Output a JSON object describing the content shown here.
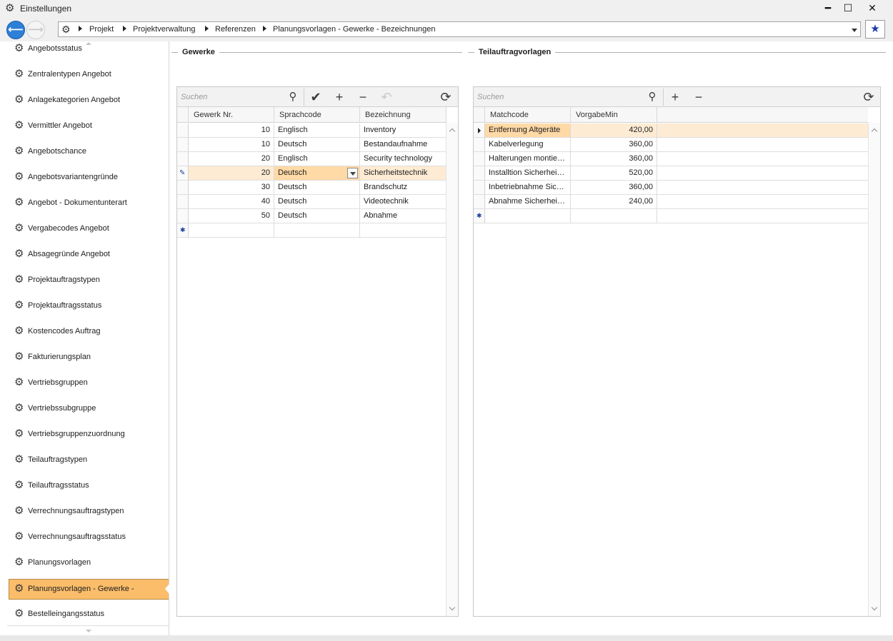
{
  "window": {
    "title": "Einstellungen",
    "controls": {
      "minimize": "━",
      "maximize": "☐",
      "close": "✕"
    }
  },
  "nav": {
    "breadcrumb": [
      "Projekt",
      "Projektverwaltung",
      "Referenzen",
      "Planungsvorlagen - Gewerke - Bezeichnungen"
    ],
    "icons": {
      "back": "back-arrow-icon",
      "forward": "forward-arrow-icon",
      "favorite": "star-icon"
    }
  },
  "sidebar": {
    "items": [
      "Angebotsstatus",
      "Zentralentypen Angebot",
      "Anlagekategorien Angebot",
      "Vermittler Angebot",
      "Angebotschance",
      "Angebotsvariantengründe",
      "Angebot - Dokumentunterart",
      "Vergabecodes Angebot",
      "Absagegründe Angebot",
      "Projektauftragstypen",
      "Projektauftragsstatus",
      "Kostencodes Auftrag",
      "Fakturierungsplan",
      "Vertriebsgruppen",
      "Vertriebssubgruppe",
      "Vertriebsgruppenzuordnung",
      "Teilauftragstypen",
      "Teilauftragsstatus",
      "Verrechnungsauftragstypen",
      "Verrechnungsauftragsstatus",
      "Planungsvorlagen",
      "Planungsvorlagen - Gewerke -",
      "Bestelleingangsstatus"
    ],
    "active_index": 21,
    "active_color": "#fbbd6a"
  },
  "gewerke": {
    "section_title": "Gewerke",
    "search_placeholder": "Suchen",
    "columns": [
      "Gewerk Nr.",
      "Sprachcode",
      "Bezeichnung"
    ],
    "rows": [
      {
        "nr": "10",
        "sprache": "Englisch",
        "bez": "Inventory"
      },
      {
        "nr": "10",
        "sprache": "Deutsch",
        "bez": "Bestandaufnahme"
      },
      {
        "nr": "20",
        "sprache": "Englisch",
        "bez": "Security technology"
      },
      {
        "nr": "20",
        "sprache": "Deutsch",
        "bez": "Sicherheitstechnik"
      },
      {
        "nr": "30",
        "sprache": "Deutsch",
        "bez": "Brandschutz"
      },
      {
        "nr": "40",
        "sprache": "Deutsch",
        "bez": "Videotechnik"
      },
      {
        "nr": "50",
        "sprache": "Deutsch",
        "bez": "Abnahme"
      }
    ],
    "editing_row": 3,
    "new_row_marker": "✱",
    "edit_marker": "✎"
  },
  "teilauftrag": {
    "section_title": "Teilauftragvorlagen",
    "search_placeholder": "Suchen",
    "columns": [
      "Matchcode",
      "VorgabeMin"
    ],
    "rows": [
      {
        "match": "Entfernung Altgeräte",
        "min": "420,00"
      },
      {
        "match": "Kabelverlegung",
        "min": "360,00"
      },
      {
        "match": "Halterungen montier…",
        "min": "360,00"
      },
      {
        "match": "Installtion Sicherheit…",
        "min": "520,00"
      },
      {
        "match": "Inbetriebnahme Sich…",
        "min": "360,00"
      },
      {
        "match": "Abnahme Sicherheit…",
        "min": "240,00"
      }
    ],
    "selected_row": 0,
    "new_row_marker": "✱"
  }
}
